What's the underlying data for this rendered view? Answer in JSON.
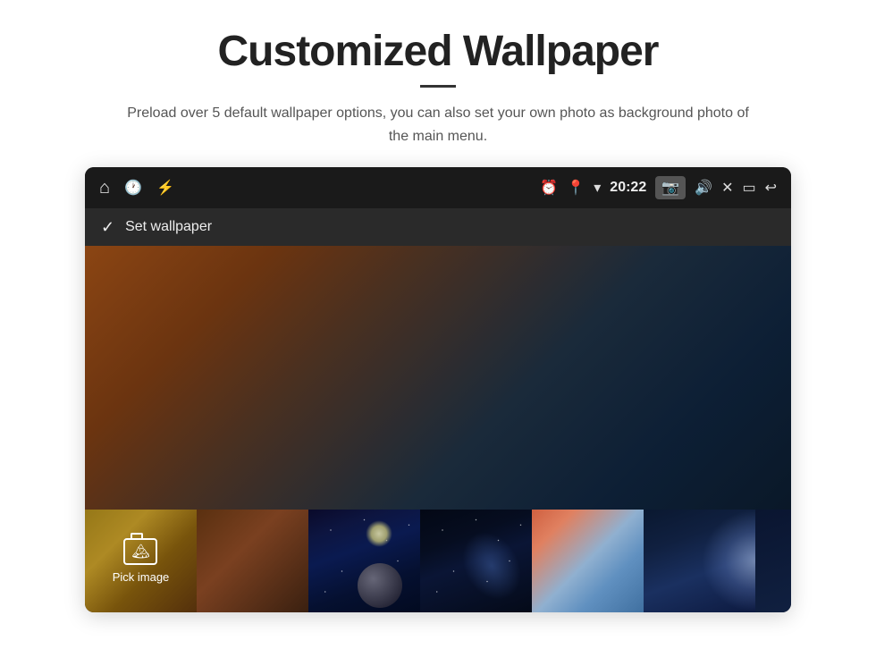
{
  "page": {
    "title": "Customized Wallpaper",
    "subtitle": "Preload over 5 default wallpaper options, you can also set your own photo as background photo of the main menu.",
    "divider": true
  },
  "device": {
    "status_bar": {
      "left_icons": [
        "home",
        "clock",
        "usb"
      ],
      "right_icons": [
        "alarm",
        "location",
        "wifi",
        "camera",
        "volume",
        "close",
        "window",
        "back"
      ],
      "time": "20:22"
    },
    "wallpaper_bar": {
      "check_label": "Set wallpaper"
    },
    "thumbnails": [
      {
        "id": 1,
        "label": "Pick image",
        "type": "pick"
      },
      {
        "id": 2,
        "label": "Warm gradient",
        "type": "warm"
      },
      {
        "id": 3,
        "label": "Space planet",
        "type": "space1"
      },
      {
        "id": 4,
        "label": "Nebula",
        "type": "space2"
      },
      {
        "id": 5,
        "label": "Sunset wave",
        "type": "wave"
      },
      {
        "id": 6,
        "label": "Blue light",
        "type": "blue"
      },
      {
        "id": 7,
        "label": "Dark space",
        "type": "dark"
      }
    ]
  }
}
